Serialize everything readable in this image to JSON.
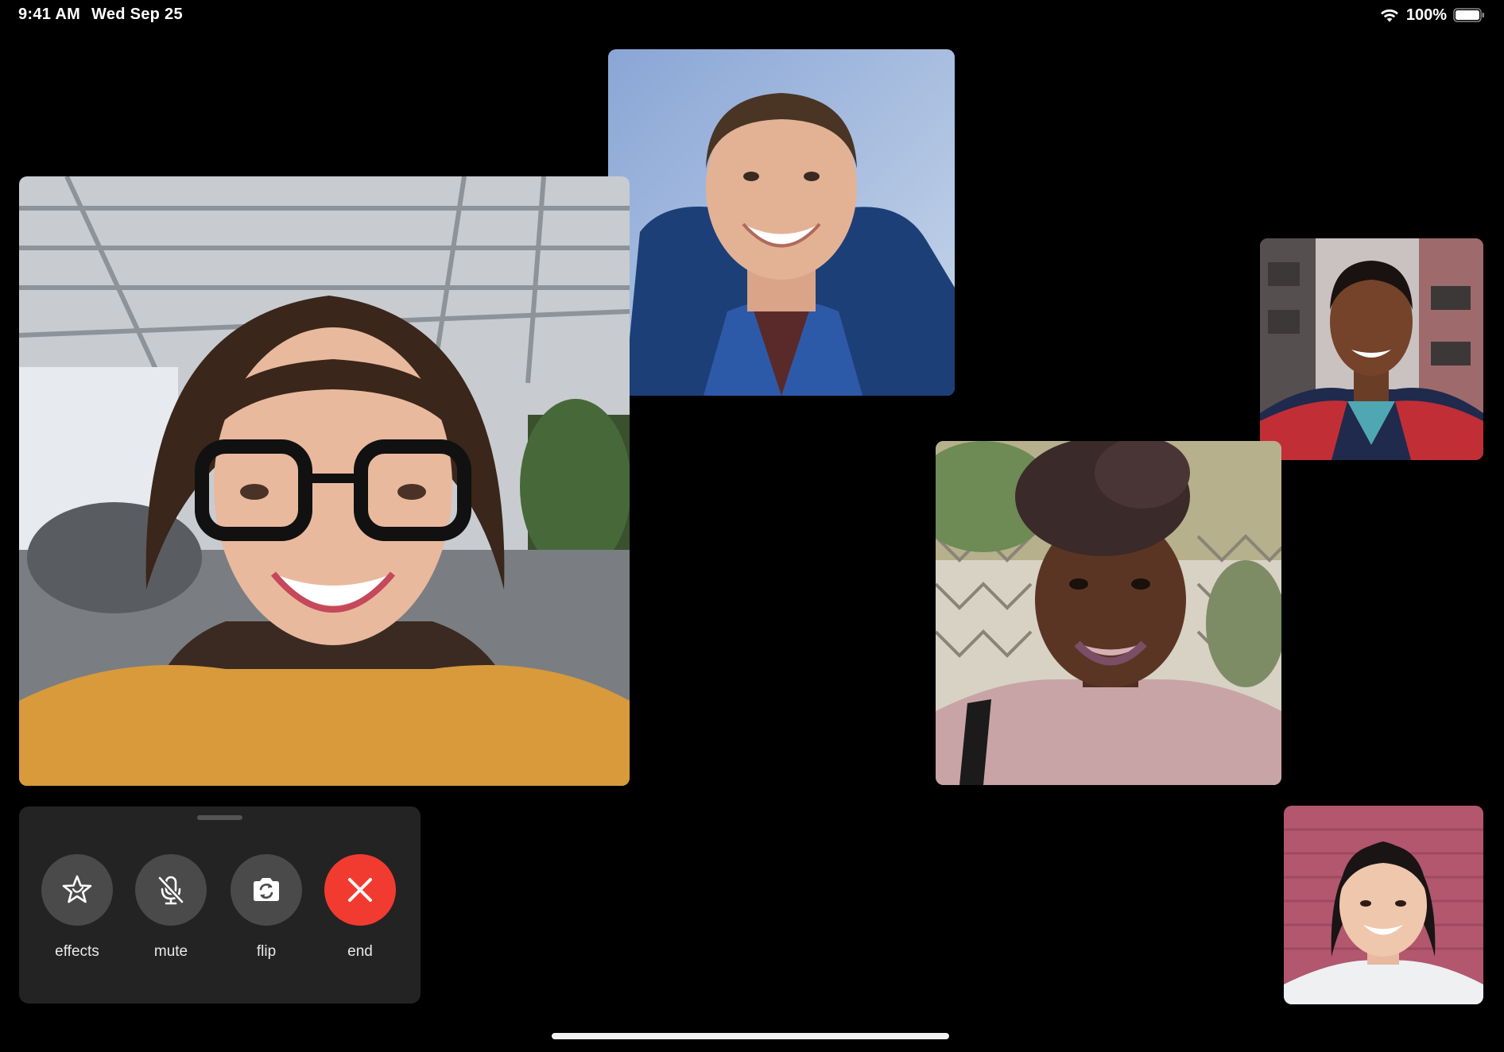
{
  "status_bar": {
    "time": "9:41 AM",
    "date": "Wed Sep 25",
    "battery_percent": "100%",
    "wifi_icon": "wifi-icon",
    "battery_icon": "battery-icon"
  },
  "participants": [
    {
      "id": "participant-1",
      "description": "woman with dark hair and black glasses, yellow patterned top, office background"
    },
    {
      "id": "participant-2",
      "description": "young man with short hair smiling, blue jacket and backpack, sky background"
    },
    {
      "id": "participant-3",
      "description": "man smiling in red and navy jacket, shop shelves background"
    },
    {
      "id": "participant-4",
      "description": "woman with curly hair smiling, pink top, fence and trees background"
    },
    {
      "id": "participant-5",
      "description": "young woman smiling, white sweater, pink brick wall background"
    }
  ],
  "controls": {
    "effects": {
      "label": "effects",
      "icon": "star-icon"
    },
    "mute": {
      "label": "mute",
      "icon": "microphone-slash-icon"
    },
    "flip": {
      "label": "flip",
      "icon": "camera-rotate-icon"
    },
    "end": {
      "label": "end",
      "icon": "close-icon",
      "color": "#f23b30"
    }
  },
  "colors": {
    "background": "#000000",
    "panel": "#232323",
    "button": "#4a4a4a",
    "end_button": "#f23b30"
  }
}
